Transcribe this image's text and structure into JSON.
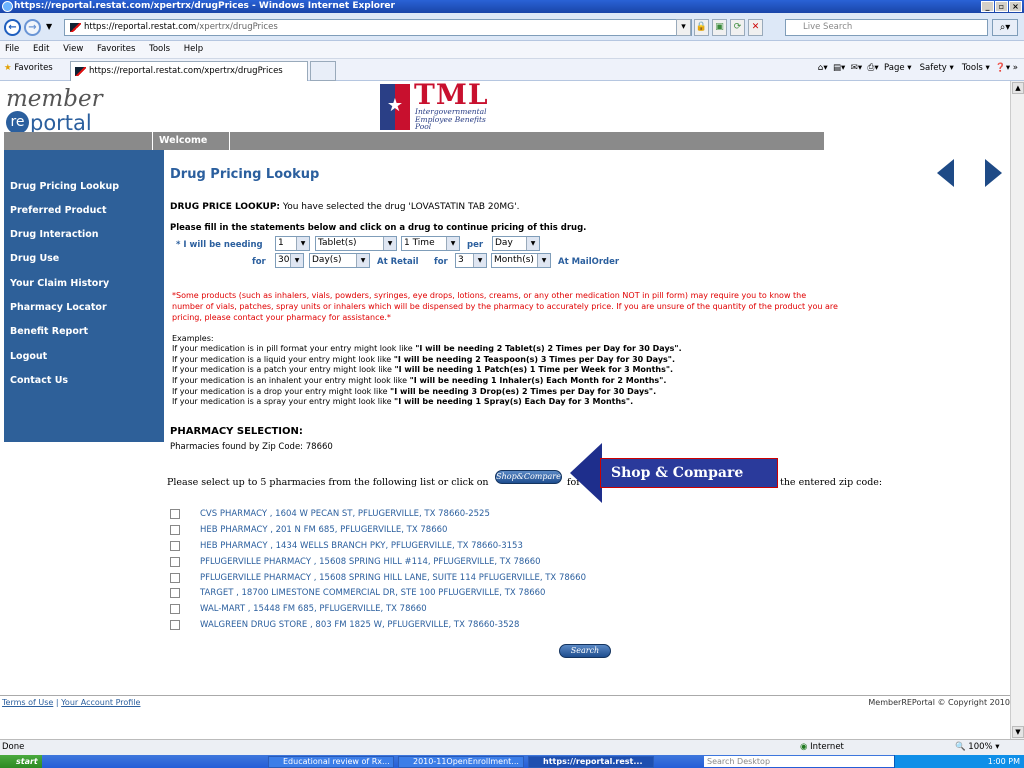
{
  "browser": {
    "title": "https://reportal.restat.com/xpertrx/drugPrices - Windows Internet Explorer",
    "address_host": "https://reportal.restat.com",
    "address_path": "/xpertrx/drugPrices",
    "search_placeholder": "Live Search",
    "menu": [
      "File",
      "Edit",
      "View",
      "Favorites",
      "Tools",
      "Help"
    ],
    "favorites_label": "Favorites",
    "tab_title": "https://reportal.restat.com/xpertrx/drugPrices",
    "command_bar": "Page ▾   Safety ▾   Tools ▾"
  },
  "header": {
    "logo_member": "member",
    "logo_re": "re",
    "logo_portal": "portal",
    "tml_title": "TML",
    "tml_line1": "Intergovernmental",
    "tml_line2": "Employee Benefits",
    "tml_line3": "Pool",
    "welcome": "Welcome"
  },
  "sidebar": {
    "items": [
      "Drug Pricing Lookup",
      "Preferred Product",
      "Drug Interaction",
      "Drug Use",
      "Your Claim History",
      "Pharmacy Locator",
      "Benefit Report",
      "Logout",
      "Contact Us"
    ]
  },
  "main": {
    "page_title": "Drug Pricing Lookup",
    "lookup_label": "DRUG PRICE LOOKUP:",
    "lookup_text": "You have selected the drug 'LOVASTATIN TAB 20MG'.",
    "instructions": "Please fill in the statements below and click on a drug to continue pricing of this drug.",
    "needing_label": "* I will be needing",
    "qty": "1",
    "unit": "Tablet(s)",
    "times": "1 Time",
    "per": "per",
    "period": "Day",
    "for": "for",
    "retail_days": "30",
    "retail_unit": "Day(s)",
    "at_retail": "At Retail",
    "mail_months": "3",
    "mail_unit": "Month(s)",
    "at_mailorder": "At MailOrder",
    "warning1": "*Some products (such as inhalers, vials, powders, syringes, eye drops, lotions, creams, or any other medication NOT in pill form) may require you to know the",
    "warning2": "number of vials, patches, spray units or inhalers which will be dispensed by the pharmacy to accurately price. If you are unsure of the quantity of the product you are",
    "warning3": "pricing, please contact your pharmacy for assistance.*",
    "examples_label": "Examples:",
    "examples": [
      {
        "pre": "If your medication is in pill format your entry might look like ",
        "bold": "\"I will be needing 2 Tablet(s) 2 Times per Day for 30 Days\"."
      },
      {
        "pre": "If your medication is a liquid your entry might look like ",
        "bold": "\"I will be needing 2 Teaspoon(s) 3 Times per Day for 30 Days\"."
      },
      {
        "pre": "If your medication is a patch your entry might look like ",
        "bold": "\"I will be needing 1 Patch(es) 1 Time per Week for 3 Months\"."
      },
      {
        "pre": "If your medication is an inhalent your entry might look like ",
        "bold": "\"I will be needing 1 Inhaler(s) Each Month for 2 Months\"."
      },
      {
        "pre": "If your medication is a drop your entry might look like ",
        "bold": "\"I will be needing 3 Drop(es) 2 Times per Day for 30 Days\"."
      },
      {
        "pre": "If your medication is a spray your entry might look like ",
        "bold": "\"I will be needing 1 Spray(s) Each Day for 3 Months\"."
      }
    ],
    "pharmacy_heading": "PHARMACY SELECTION:",
    "zip_text": "Pharmacies found by Zip Code: 78660",
    "select_pre": "Please select up to 5 pharmacies from the following list or click on",
    "shop_compare_btn": "Shop&Compare",
    "select_for": "for",
    "select_post": "the entered zip code:",
    "callout": "Shop & Compare",
    "pharmacies": [
      "CVS PHARMACY , 1604 W PECAN ST, PFLUGERVILLE, TX 78660-2525",
      "HEB PHARMACY , 201 N FM 685, PFLUGERVILLE, TX 78660",
      "HEB PHARMACY , 1434 WELLS BRANCH PKY, PFLUGERVILLE, TX 78660-3153",
      "PFLUGERVILLE PHARMACY , 15608 SPRING HILL #114, PFLUGERVILLE, TX 78660",
      "PFLUGERVILLE PHARMACY , 15608 SPRING HILL LANE, SUITE 114 PFLUGERVILLE, TX 78660",
      "TARGET , 18700 LIMESTONE COMMERCIAL DR, STE 100 PFLUGERVILLE, TX 78660",
      "WAL-MART , 15448 FM 685, PFLUGERVILLE, TX 78660",
      "WALGREEN DRUG STORE , 803 FM 1825 W, PFLUGERVILLE, TX 78660-3528"
    ],
    "search_btn": "Search"
  },
  "footer": {
    "terms": "Terms of Use",
    "sep": "|",
    "profile": "Your Account Profile",
    "copyright": "MemberREPortal © Copyright 2010"
  },
  "status": {
    "left": "Done",
    "zone": "Internet",
    "zoom": "100%"
  },
  "taskbar": {
    "start": "start",
    "tasks": [
      "Educational review of Rx...",
      "2010-11OpenEnrollment...",
      "https://reportal.rest..."
    ],
    "search_placeholder": "Search Desktop",
    "clock": "1:00 PM"
  }
}
